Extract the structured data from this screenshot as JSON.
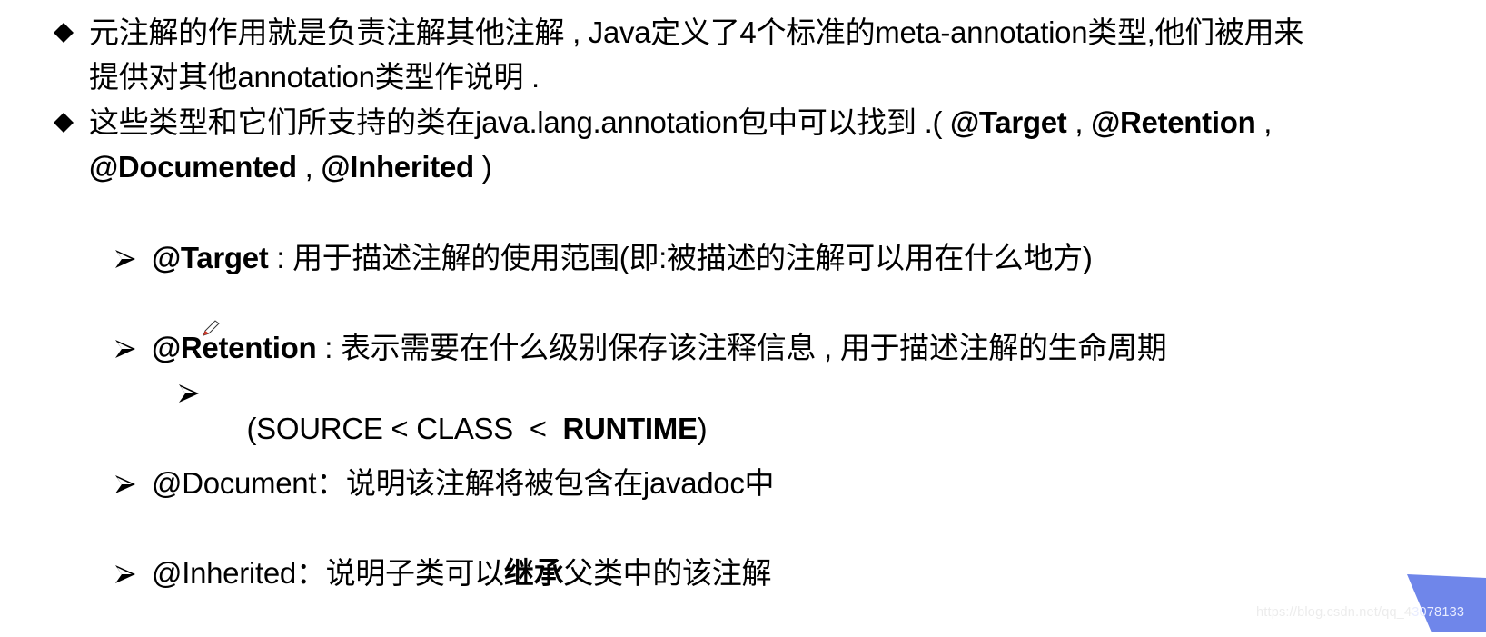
{
  "bullets": [
    {
      "marker": "diamond",
      "lines": [
        [
          {
            "text": "元注解的作用就是负责注解其他注解 , Java定义了4个标准的meta-annotation类型,他们被用来",
            "bold": false
          }
        ],
        [
          {
            "text": "提供对其他annotation类型作说明 .",
            "bold": false
          }
        ]
      ]
    },
    {
      "marker": "diamond",
      "lines": [
        [
          {
            "text": "这些类型和它们所支持的类在java.lang.annotation包中可以找到 .( ",
            "bold": false
          },
          {
            "text": "@Target",
            "bold": true
          },
          {
            "text": " , ",
            "bold": false
          },
          {
            "text": "@Retention",
            "bold": true
          },
          {
            "text": " ,",
            "bold": false
          }
        ],
        [
          {
            "text": "@Documented",
            "bold": true
          },
          {
            "text": " , ",
            "bold": false
          },
          {
            "text": "@Inherited",
            "bold": true
          },
          {
            "text": " )",
            "bold": false
          }
        ]
      ]
    }
  ],
  "sub_items": [
    {
      "name": "@Target",
      "name_bold": true,
      "separator": " : ",
      "description": "用于描述注解的使用范围(即:被描述的注解可以用在什么地方)"
    },
    {
      "name": "@Retention",
      "name_bold": true,
      "separator": " : ",
      "description": "表示需要在什么级别保存该注释信息 , 用于描述注解的生命周期",
      "children": [
        {
          "prefix": "(SOURCE < CLASS  <  ",
          "bold": "RUNTIME",
          "suffix": ")"
        }
      ]
    },
    {
      "name": "@Document",
      "name_bold": false,
      "separator": "：",
      "description": "说明该注解将被包含在javadoc中"
    },
    {
      "name": "@Inherited",
      "name_bold": false,
      "separator": "：",
      "description_before": "说明子类可以",
      "description_bold": "继承",
      "description_after": "父类中的该注解"
    }
  ],
  "watermark": {
    "light_part": "https://blog.csdn.net/qq_4",
    "dark_part": "3078133"
  },
  "colors": {
    "text": "#000000",
    "corner_accent": "#6f86ea",
    "pencil_tip": "#d83a2a"
  }
}
